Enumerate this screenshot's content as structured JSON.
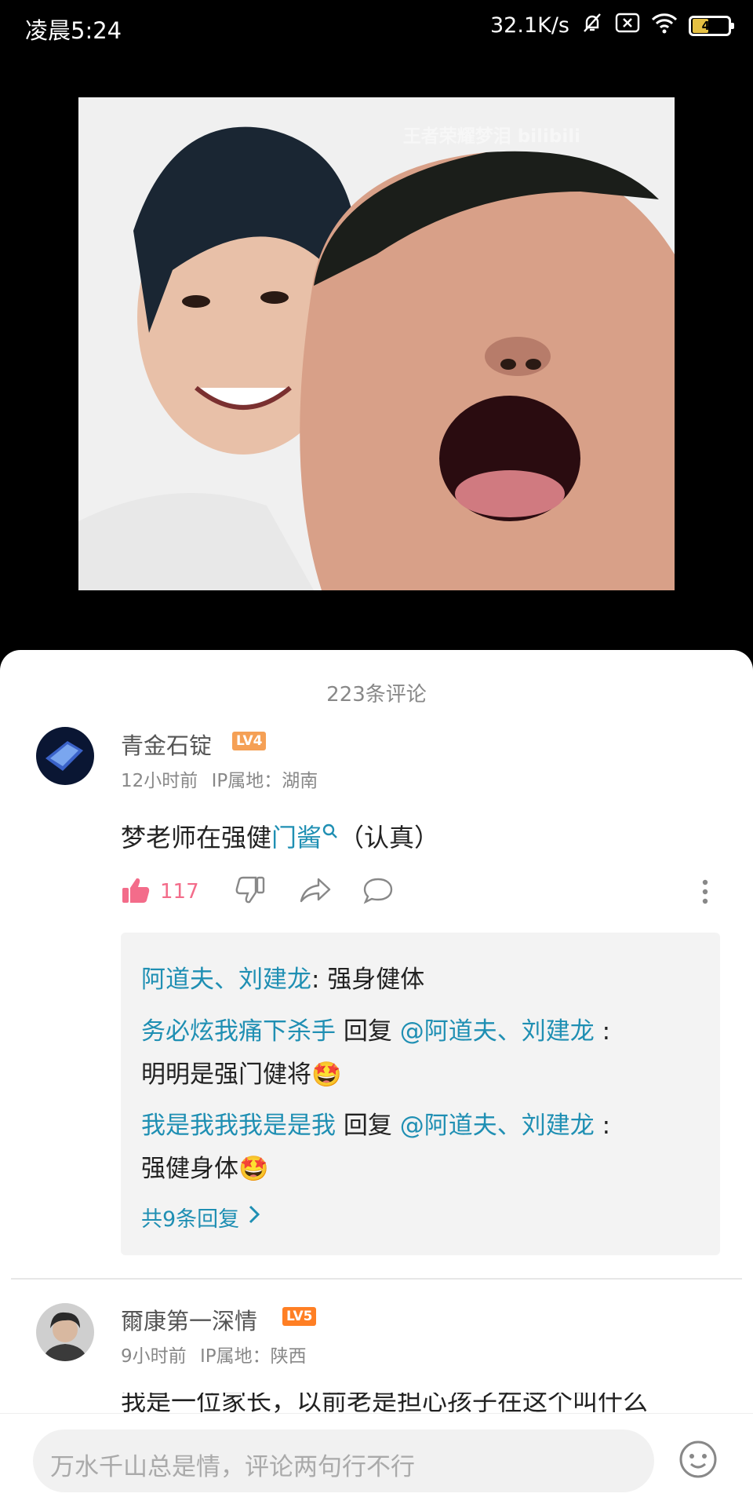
{
  "status_bar": {
    "time": "凌晨5:24",
    "network_speed": "32.1K/s",
    "battery_level": "41",
    "battery_color": "#e5c043"
  },
  "video": {
    "watermark": "王者荣耀梦泪 bilibili"
  },
  "comments": {
    "count_label": "223条评论",
    "items": [
      {
        "username": "青金石锭",
        "level": "LV4",
        "level_color": "#f5a055",
        "time": "12小时前",
        "ip_location": "IP属地：湖南",
        "text_before_link": "梦老师在强健",
        "link_text": "门酱",
        "text_after_link": "（认真）",
        "like_count": "117",
        "replies": [
          {
            "author": "阿道夫、刘建龙",
            "separator": ": ",
            "text": "强身健体"
          },
          {
            "author": "务必炫我痛下杀手",
            "reply_word": " 回复 ",
            "target": "@阿道夫、刘建龙",
            "colon": " :",
            "text": "明明是强门健将",
            "emoji": "🤩"
          },
          {
            "author": "我是我我我是是我",
            "reply_word": " 回复 ",
            "target": "@阿道夫、刘建龙",
            "colon": " :",
            "text": "强健身体",
            "emoji": "🤩"
          }
        ],
        "more_replies": "共9条回复"
      },
      {
        "username": "爾康第一深情",
        "level": "LV5",
        "level_color": "#ff7f24",
        "time": "9小时前",
        "ip_location": "IP属地：陕西",
        "text": "我是一位家长，以前老是担心孩子在这个叫什么"
      }
    ]
  },
  "input": {
    "placeholder": "万水千山总是情，评论两句行不行"
  },
  "icons": [
    "mute-bell-icon",
    "sim-off-icon",
    "wifi-icon",
    "battery-icon",
    "thumbs-up-icon",
    "thumbs-down-icon",
    "share-icon",
    "comment-icon",
    "more-icon",
    "search-icon",
    "chevron-right-icon",
    "emoji-icon"
  ]
}
